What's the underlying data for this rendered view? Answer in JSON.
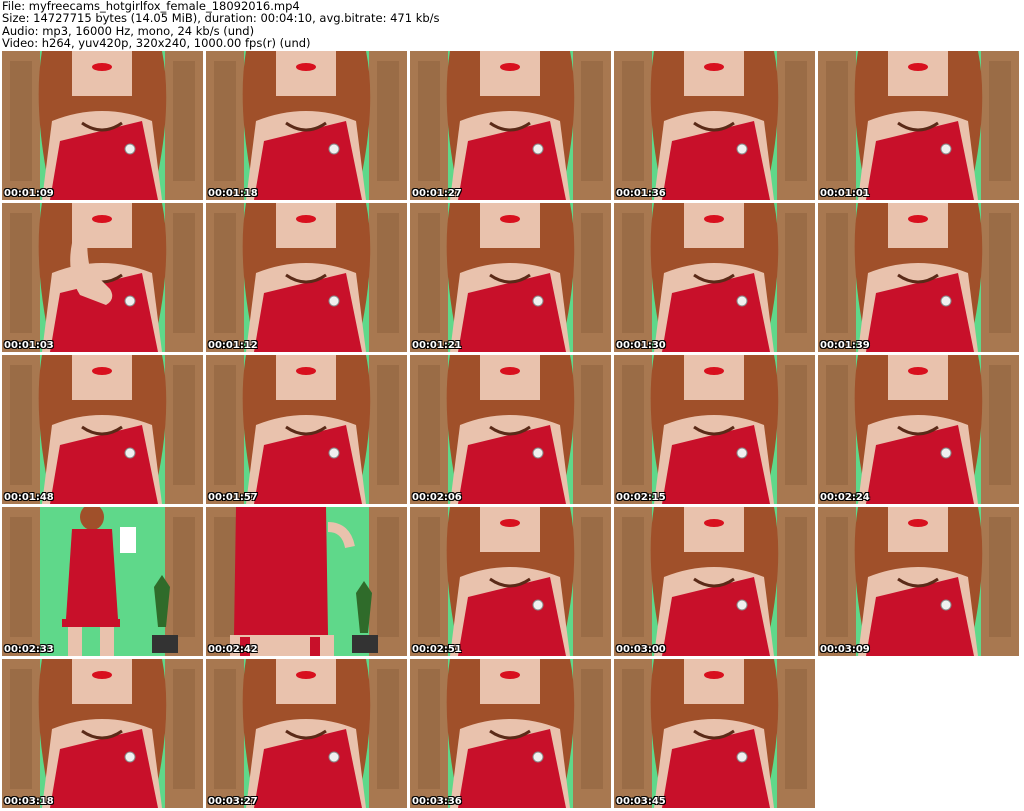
{
  "header": {
    "file_line": "File: myfreecams_hotgirlfox_female_18092016.mp4",
    "size_line": "Size: 14727715 bytes (14.05 MiB), duration: 00:04:10, avg.bitrate: 471 kb/s",
    "audio_line": "Audio: mp3, 16000 Hz, mono, 24 kb/s (und)",
    "video_line": "Video: h264, yuv420p, 320x240, 1000.00 fps(r) (und)"
  },
  "colors": {
    "wall": "#5fd88a",
    "door": "#a87850",
    "dress": "#c8102a",
    "hair": "#a0502a",
    "skin": "#e9c2ad"
  },
  "thumbnails": [
    {
      "timestamp": "00:01:09",
      "scene": "closeup"
    },
    {
      "timestamp": "00:01:18",
      "scene": "closeup"
    },
    {
      "timestamp": "00:01:27",
      "scene": "closeup"
    },
    {
      "timestamp": "00:01:36",
      "scene": "closeup"
    },
    {
      "timestamp": "00:01:01",
      "scene": "closeup"
    },
    {
      "timestamp": "00:01:03",
      "scene": "closeup-hand"
    },
    {
      "timestamp": "00:01:12",
      "scene": "closeup"
    },
    {
      "timestamp": "00:01:21",
      "scene": "closeup"
    },
    {
      "timestamp": "00:01:30",
      "scene": "closeup"
    },
    {
      "timestamp": "00:01:39",
      "scene": "closeup"
    },
    {
      "timestamp": "00:01:48",
      "scene": "closeup"
    },
    {
      "timestamp": "00:01:57",
      "scene": "closeup"
    },
    {
      "timestamp": "00:02:06",
      "scene": "closeup"
    },
    {
      "timestamp": "00:02:15",
      "scene": "closeup"
    },
    {
      "timestamp": "00:02:24",
      "scene": "closeup"
    },
    {
      "timestamp": "00:02:33",
      "scene": "fullbody"
    },
    {
      "timestamp": "00:02:42",
      "scene": "torso"
    },
    {
      "timestamp": "00:02:51",
      "scene": "closeup"
    },
    {
      "timestamp": "00:03:00",
      "scene": "closeup"
    },
    {
      "timestamp": "00:03:09",
      "scene": "closeup"
    },
    {
      "timestamp": "00:03:18",
      "scene": "closeup"
    },
    {
      "timestamp": "00:03:27",
      "scene": "closeup"
    },
    {
      "timestamp": "00:03:36",
      "scene": "closeup"
    },
    {
      "timestamp": "00:03:45",
      "scene": "closeup"
    }
  ]
}
